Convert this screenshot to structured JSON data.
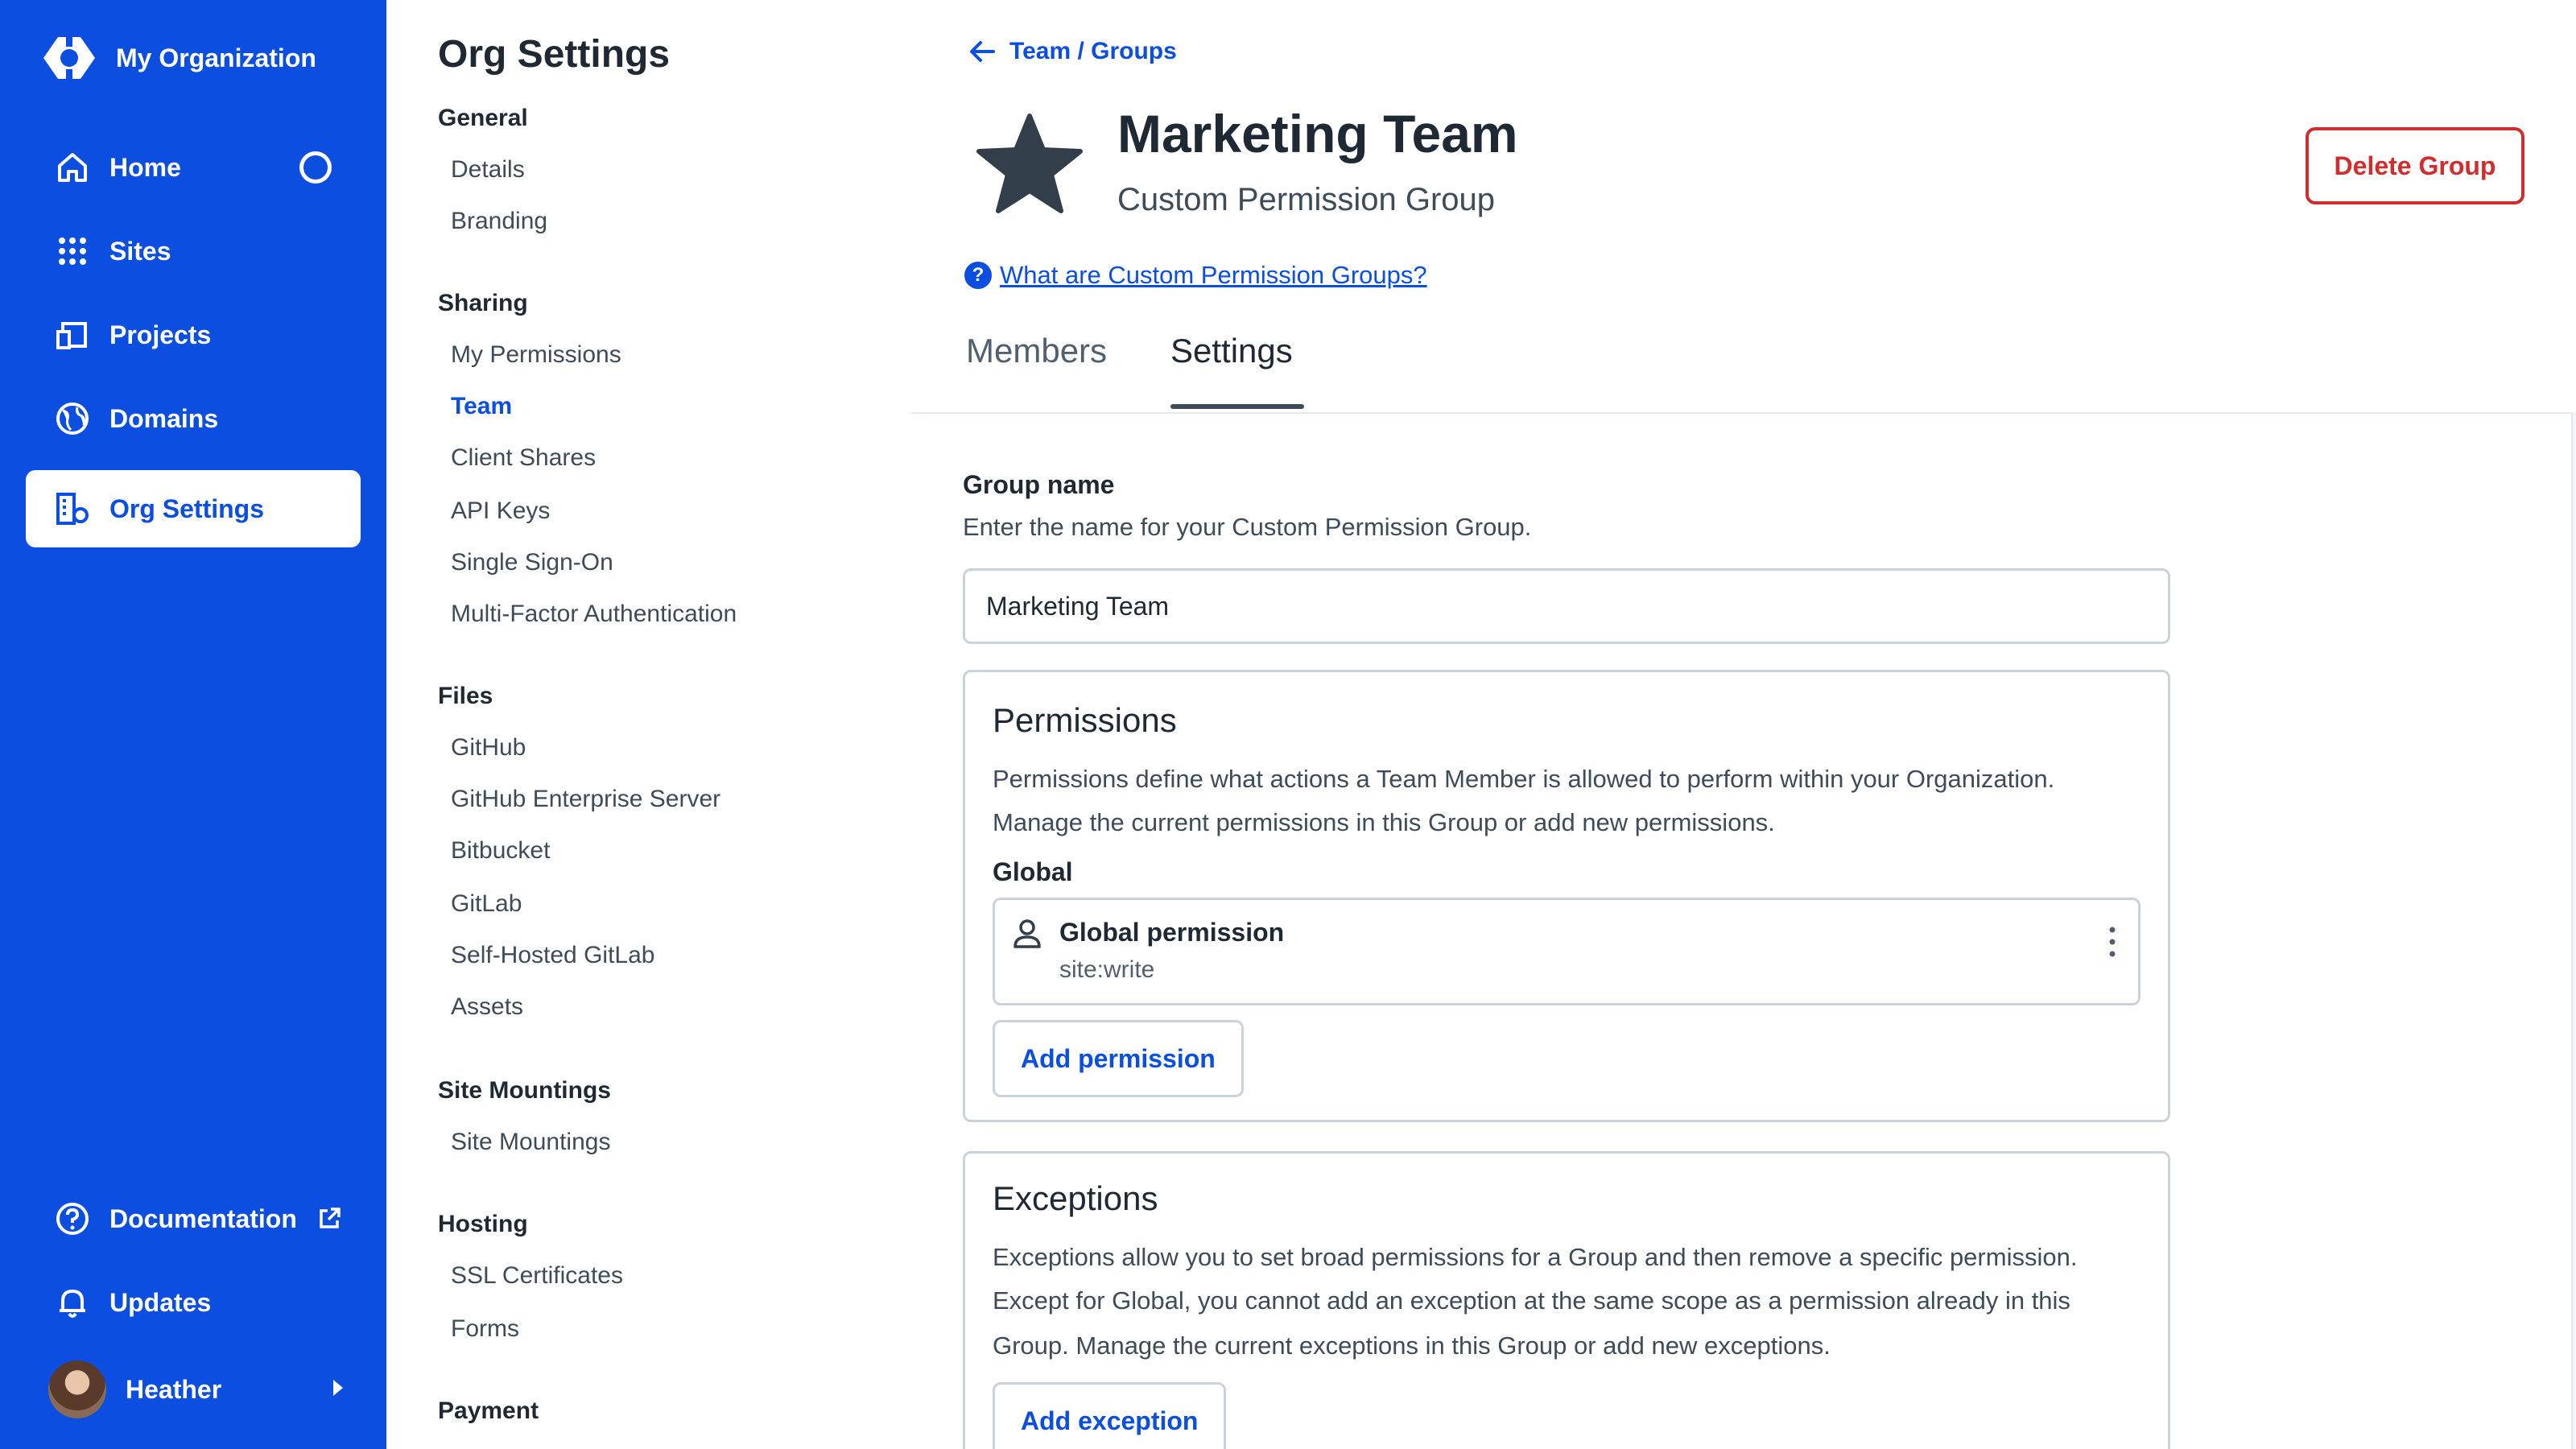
{
  "app": {
    "org_name": "My Organization"
  },
  "nav": {
    "items": [
      {
        "label": "Home",
        "icon": "home-icon"
      },
      {
        "label": "Sites",
        "icon": "grid-icon"
      },
      {
        "label": "Projects",
        "icon": "projects-icon"
      },
      {
        "label": "Domains",
        "icon": "globe-icon"
      },
      {
        "label": "Org Settings",
        "icon": "org-settings-icon",
        "active": true
      }
    ],
    "bottom": [
      {
        "label": "Documentation",
        "icon": "help-circle-icon"
      },
      {
        "label": "Updates",
        "icon": "bell-icon"
      }
    ],
    "user": {
      "name": "Heather"
    }
  },
  "org_settings": {
    "title": "Org Settings",
    "sections": [
      {
        "heading": "General",
        "items": [
          "Details",
          "Branding"
        ]
      },
      {
        "heading": "Sharing",
        "items": [
          "My Permissions",
          "Team",
          "Client Shares",
          "API Keys",
          "Single Sign-On",
          "Multi-Factor Authentication"
        ]
      },
      {
        "heading": "Files",
        "items": [
          "GitHub",
          "GitHub Enterprise Server",
          "Bitbucket",
          "GitLab",
          "Self-Hosted GitLab",
          "Assets"
        ]
      },
      {
        "heading": "Site Mountings",
        "items": [
          "Site Mountings"
        ]
      },
      {
        "heading": "Hosting",
        "items": [
          "SSL Certificates",
          "Forms"
        ]
      },
      {
        "heading": "Payment",
        "items": []
      }
    ],
    "active_item": "Team"
  },
  "header": {
    "breadcrumb": "Team / Groups",
    "title": "Marketing Team",
    "subtitle": "Custom Permission Group",
    "delete_label": "Delete Group",
    "help_link": "What are Custom Permission Groups?"
  },
  "tabs": {
    "members": "Members",
    "settings": "Settings",
    "active": "Settings"
  },
  "form": {
    "group_name_label": "Group name",
    "group_name_help": "Enter the name for your Custom Permission Group.",
    "group_name_value": "Marketing Team"
  },
  "permissions": {
    "title": "Permissions",
    "description_1": "Permissions define what actions a Team Member is allowed to perform within your Organization.",
    "description_2": "Manage the current permissions in this Group or add new permissions.",
    "scope_label": "Global",
    "item_name": "Global permission",
    "item_value": "site:write",
    "add_label": "Add permission"
  },
  "exceptions": {
    "title": "Exceptions",
    "description_1": "Exceptions allow you to set broad permissions for a Group and then remove a specific permission.",
    "description_2": "Except for Global, you cannot add an exception at the same scope as a permission already in this",
    "description_3": "Group. Manage the current exceptions in this Group or add new exceptions.",
    "add_label": "Add exception"
  }
}
